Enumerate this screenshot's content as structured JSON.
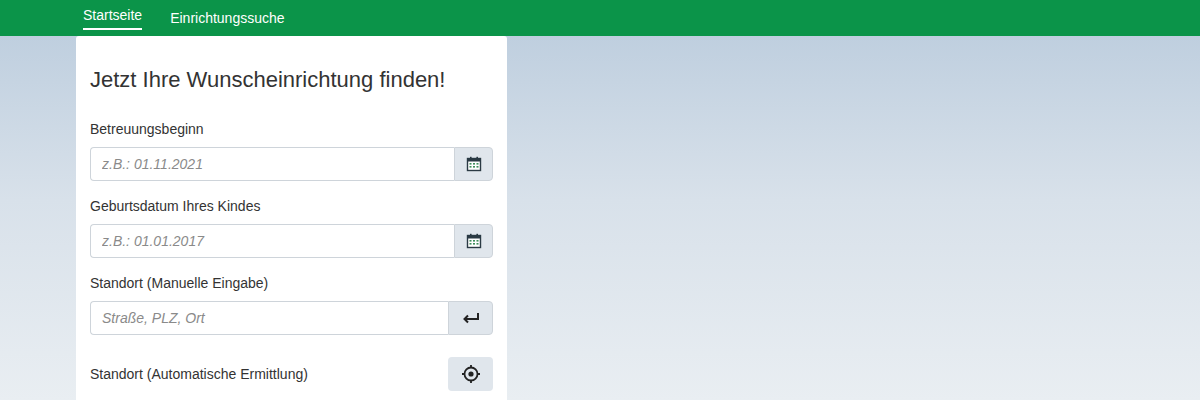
{
  "nav": {
    "items": [
      {
        "label": "Startseite",
        "selected": true
      },
      {
        "label": "Einrichtungssuche",
        "selected": false
      }
    ]
  },
  "form": {
    "title": "Jetzt Ihre Wunscheinrichtung finden!",
    "fields": [
      {
        "label": "Betreuungsbeginn",
        "placeholder": "z.B.: 01.11.2021",
        "kind": "date"
      },
      {
        "label": "Geburtsdatum Ihres Kindes",
        "placeholder": "z.B.: 01.01.2017",
        "kind": "date"
      },
      {
        "label": "Standort (Manuelle Eingabe)",
        "placeholder": "Straße, PLZ, Ort",
        "kind": "address"
      }
    ],
    "locate": {
      "label": "Standort (Automatische Ermittlung)"
    }
  }
}
